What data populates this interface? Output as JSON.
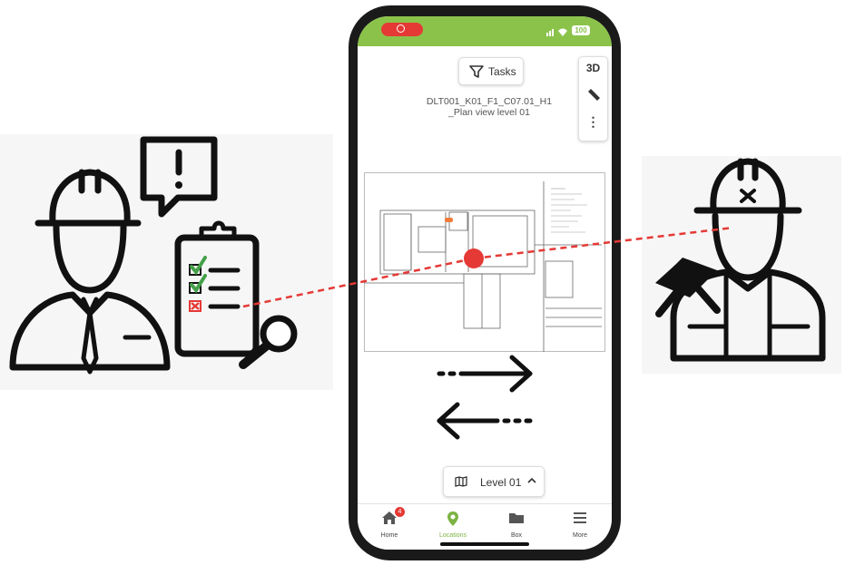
{
  "status_bar": {
    "battery": "100"
  },
  "toolbar": {
    "tasks_label": "Tasks"
  },
  "side_tools": {
    "three_d_label": "3D",
    "more_label": "⋮"
  },
  "plan": {
    "title_line1": "DLT001_K01_F1_C07.01_H1",
    "title_line2": "_Plan view level 01"
  },
  "level_selector": {
    "label": "Level 01"
  },
  "nav": {
    "items": [
      {
        "label": "Home",
        "badge": "4"
      },
      {
        "label": "Locations"
      },
      {
        "label": "Box"
      },
      {
        "label": "More"
      }
    ]
  },
  "colors": {
    "accent": "#8bc34a",
    "link_line": "#e53935",
    "marker": "#e53935"
  },
  "icons": [
    "hard-hat-icon",
    "alert-bubble-icon",
    "clipboard-checklist-icon",
    "magnifier-icon",
    "hammer-icon",
    "swap-arrows-icon",
    "filter-icon",
    "ruler-icon",
    "map-icon",
    "home-icon",
    "location-pin-icon",
    "folder-icon",
    "menu-icon"
  ]
}
